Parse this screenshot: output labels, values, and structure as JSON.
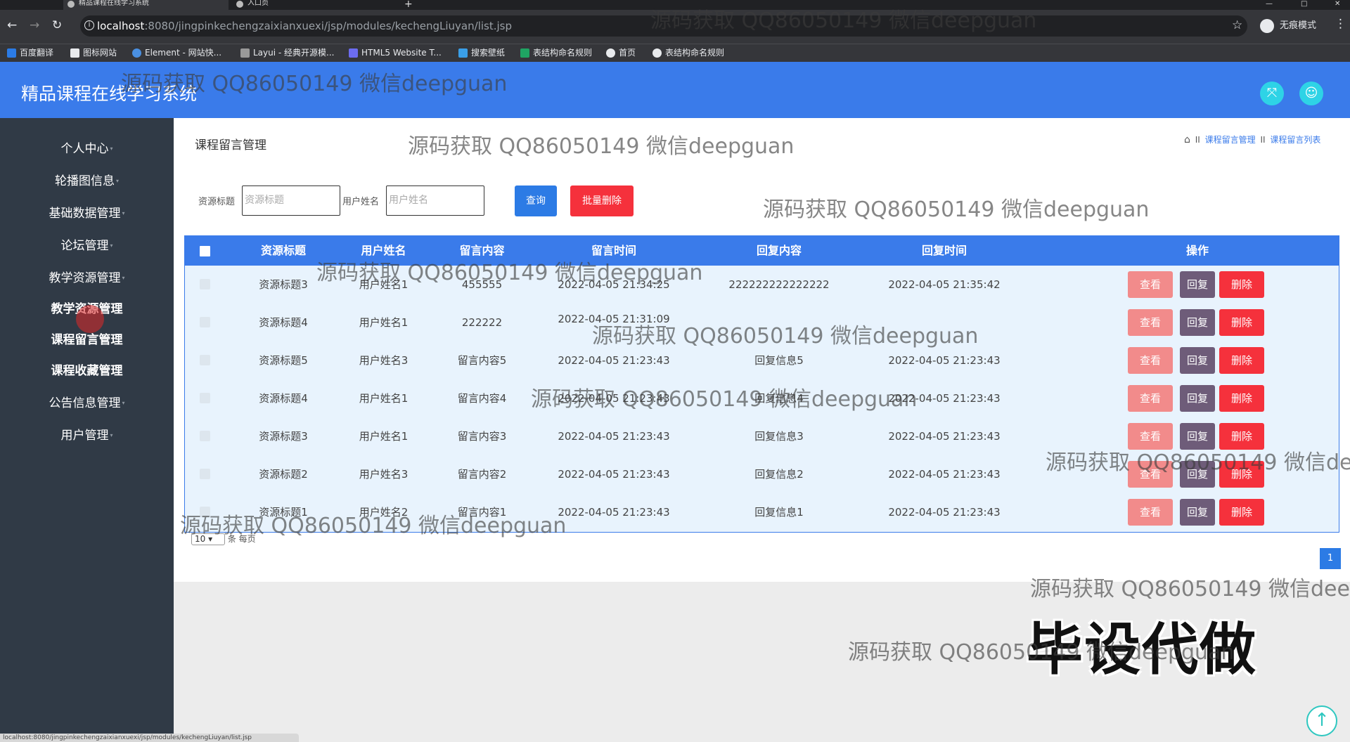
{
  "browser": {
    "tabs": [
      {
        "label": "精品课程在线学习系统",
        "active": true
      },
      {
        "label": "入口页",
        "active": false
      }
    ],
    "url_host": "localhost",
    "url_path": ":8080/jingpinkechengzaixianxuexi/jsp/modules/kechengLiuyan/list.jsp",
    "incognito_label": "无痕模式",
    "bookmarks": [
      "百度翻译",
      "图标网站",
      "Element - 网站快...",
      "Layui - 经典开源模...",
      "HTML5 Website T...",
      "搜索壁纸",
      "表结构命名规则",
      "首页",
      "表结构命名规则"
    ],
    "status_url": "localhost:8080/jingpinkechengzaixianxuexi/jsp/modules/kechengLiuyan/list.jsp"
  },
  "app": {
    "title": "精品课程在线学习系统"
  },
  "sidebar": {
    "items": [
      {
        "label": "个人中心"
      },
      {
        "label": "轮播图信息"
      },
      {
        "label": "基础数据管理"
      },
      {
        "label": "论坛管理"
      },
      {
        "label": "教学资源管理"
      },
      {
        "label": "教学资源管理"
      },
      {
        "label": "课程留言管理"
      },
      {
        "label": "课程收藏管理"
      },
      {
        "label": "公告信息管理"
      },
      {
        "label": "用户管理"
      }
    ]
  },
  "page": {
    "title": "课程留言管理",
    "breadcrumb": [
      "课程留言管理",
      "课程留言列表"
    ],
    "breadcrumb_sep": "II"
  },
  "search": {
    "resource_label": "资源标题",
    "resource_placeholder": "资源标题",
    "user_label": "用户姓名",
    "user_placeholder": "用户姓名",
    "query_button": "查询",
    "batch_delete_button": "批量删除"
  },
  "table": {
    "headers": [
      "资源标题",
      "用户姓名",
      "留言内容",
      "留言时间",
      "回复内容",
      "回复时间",
      "操作"
    ],
    "action_labels": {
      "view": "查看",
      "reply": "回复",
      "delete": "删除"
    },
    "rows": [
      {
        "resource": "资源标题3",
        "user": "用户姓名1",
        "content": "455555",
        "time": "2022-04-05 21:34:25",
        "reply": "222222222222222",
        "reply_time": "2022-04-05 21:35:42"
      },
      {
        "resource": "资源标题4",
        "user": "用户姓名1",
        "content": "222222",
        "time": "2022-04-05 21:31:09",
        "reply": "",
        "reply_time": ""
      },
      {
        "resource": "资源标题5",
        "user": "用户姓名3",
        "content": "留言内容5",
        "time": "2022-04-05 21:23:43",
        "reply": "回复信息5",
        "reply_time": "2022-04-05 21:23:43"
      },
      {
        "resource": "资源标题4",
        "user": "用户姓名1",
        "content": "留言内容4",
        "time": "2022-04-05 21:23:43",
        "reply": "回复信息4",
        "reply_time": "2022-04-05 21:23:43"
      },
      {
        "resource": "资源标题3",
        "user": "用户姓名1",
        "content": "留言内容3",
        "time": "2022-04-05 21:23:43",
        "reply": "回复信息3",
        "reply_time": "2022-04-05 21:23:43"
      },
      {
        "resource": "资源标题2",
        "user": "用户姓名3",
        "content": "留言内容2",
        "time": "2022-04-05 21:23:43",
        "reply": "回复信息2",
        "reply_time": "2022-04-05 21:23:43"
      },
      {
        "resource": "资源标题1",
        "user": "用户姓名2",
        "content": "留言内容1",
        "time": "2022-04-05 21:23:43",
        "reply": "回复信息1",
        "reply_time": "2022-04-05 21:23:43"
      }
    ]
  },
  "pagination": {
    "page_size": "10",
    "page_size_suffix": "条 每页",
    "current_page": "1"
  },
  "overlay": {
    "watermark": "源码获取 QQ86050149 微信deepguan",
    "banner": "毕设代做"
  },
  "colors": {
    "header": "#3a7bea",
    "sidebar": "#303a46",
    "view": "#f28b8b",
    "reply": "#6e5c79",
    "delete": "#f5313c",
    "query": "#2c7be5"
  }
}
